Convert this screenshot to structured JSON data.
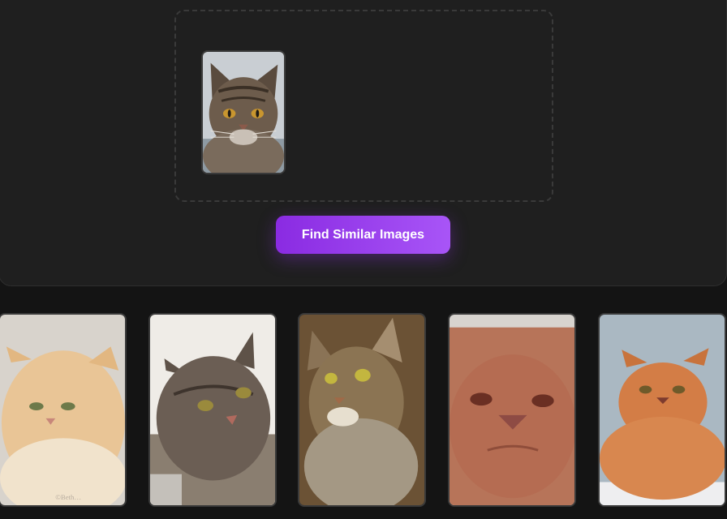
{
  "upload": {
    "uploaded_image": {
      "alt": "tabby cat",
      "icon": "cat-photo"
    }
  },
  "actions": {
    "find_similar_label": "Find Similar Images",
    "accent_color": "#9333ea"
  },
  "results": [
    {
      "alt": "cream persian cat",
      "watermark": "©Beth…"
    },
    {
      "alt": "long-haired tabby cat"
    },
    {
      "alt": "maine coon tabby cat"
    },
    {
      "alt": "red persian cat close-up"
    },
    {
      "alt": "orange persian cat"
    }
  ]
}
